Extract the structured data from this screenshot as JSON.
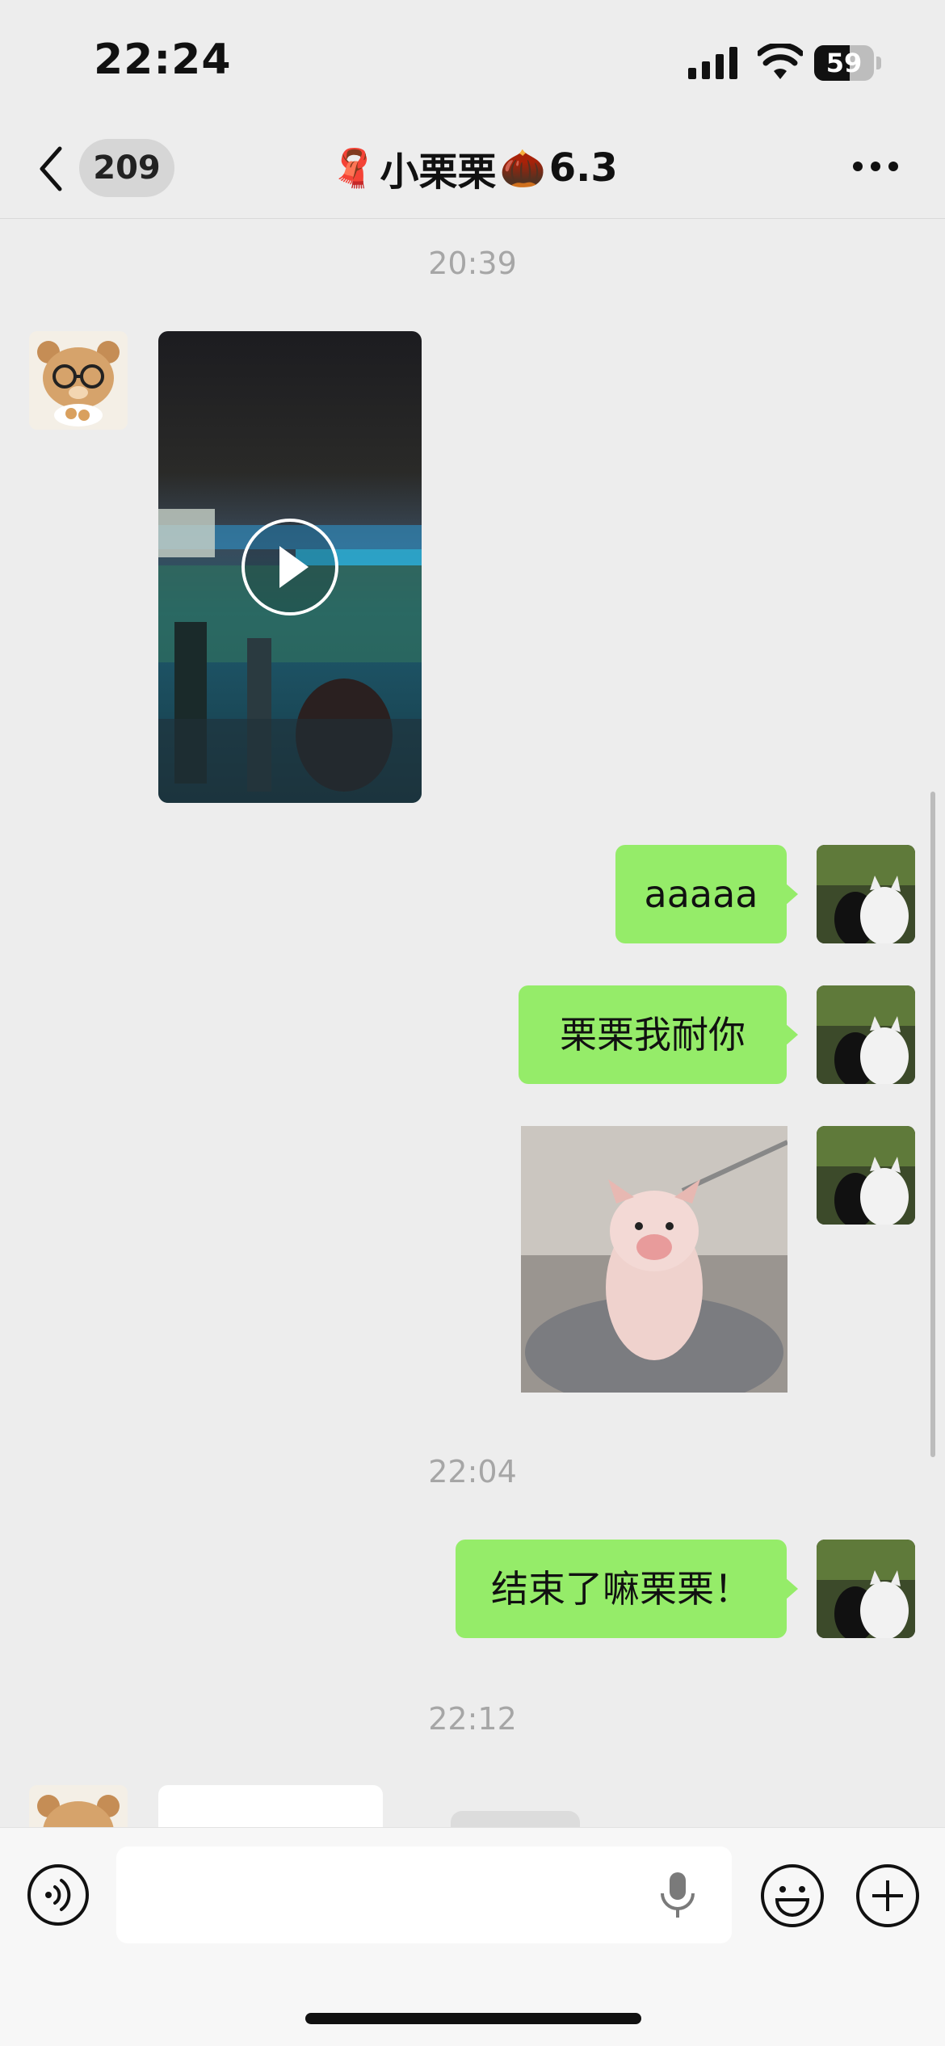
{
  "status_bar": {
    "time": "22:24",
    "battery": "59",
    "battery_level": 0.59
  },
  "nav": {
    "unread_count": "209",
    "title_left_emoji": "🧣",
    "title_name": "小栗栗",
    "title_right_emoji": "🌰",
    "title_suffix": "6.3"
  },
  "messages": {
    "ts1": "20:39",
    "msg_aaaaa": "aaaaa",
    "msg_lili": "栗栗我耐你",
    "ts2": "22:04",
    "msg_end": "结束了嘛栗栗！",
    "ts3": "22:12"
  },
  "colors": {
    "bubble_green": "#95ec69",
    "background": "#ededed"
  },
  "icons": [
    "back-arrow-icon",
    "more-icon",
    "play-icon",
    "voice-icon",
    "mic-icon",
    "emoji-icon",
    "plus-icon"
  ]
}
